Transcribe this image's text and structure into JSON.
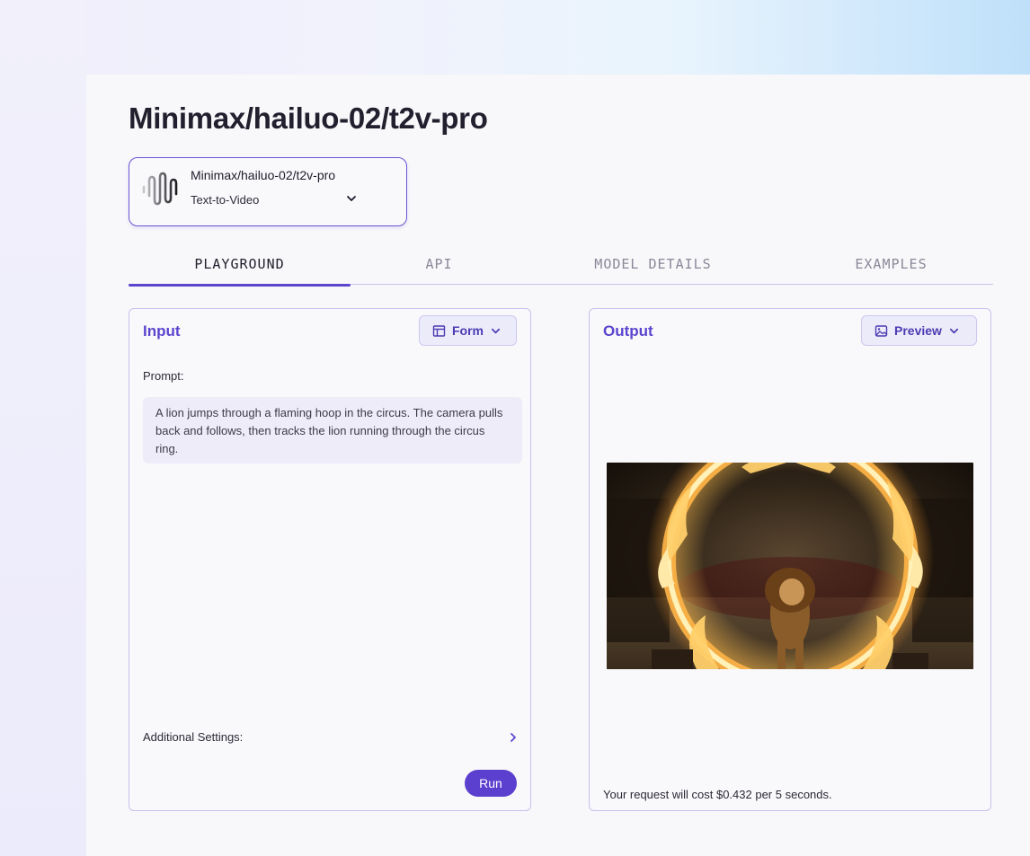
{
  "page": {
    "title": "Minimax/hailuo-02/t2v-pro"
  },
  "model_selector": {
    "name": "Minimax/hailuo-02/t2v-pro",
    "type": "Text-to-Video",
    "logo_icon": "waveform-logo-icon",
    "chevron_icon": "chevron-down-icon"
  },
  "tabs": [
    {
      "label": "PLAYGROUND",
      "active": true
    },
    {
      "label": "API",
      "active": false
    },
    {
      "label": "MODEL DETAILS",
      "active": false
    },
    {
      "label": "EXAMPLES",
      "active": false
    }
  ],
  "input_panel": {
    "title": "Input",
    "mode_button": {
      "label": "Form",
      "icon": "table-icon"
    },
    "prompt_label": "Prompt:",
    "prompt_value": "A lion jumps through a flaming hoop in the circus. The camera pulls back and follows, then tracks the lion running through the circus ring.",
    "additional_settings_label": "Additional Settings:",
    "run_label": "Run"
  },
  "output_panel": {
    "title": "Output",
    "view_button": {
      "label": "Preview",
      "icon": "image-icon"
    },
    "media_subject": "lion-flaming-hoop-video-frame",
    "cost_text": "Your request will cost $0.432 per 5 seconds."
  },
  "colors": {
    "accent": "#5b3fcf",
    "panel_border": "#c8c2ee",
    "tab_active": "#22202e",
    "tab_inactive": "#8a8898"
  }
}
